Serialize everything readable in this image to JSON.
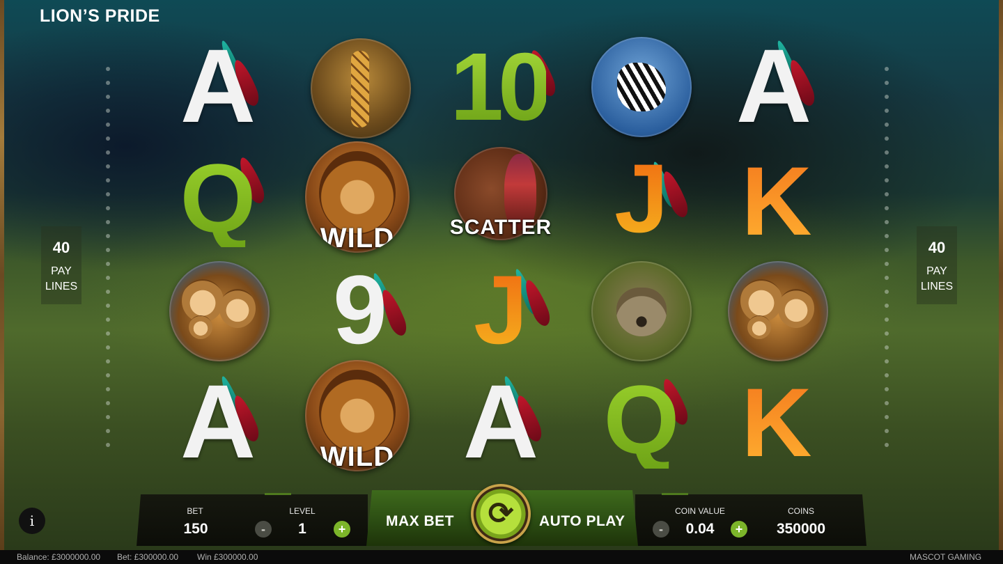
{
  "title": "LION’S PRIDE",
  "paylines": {
    "count": "40",
    "label_line1": "PAY",
    "label_line2": "LINES"
  },
  "reels": {
    "r1": {
      "a1": "A",
      "q": "Q",
      "a2": "A"
    },
    "r2": {
      "wild1": "WILD",
      "wild2": "WILD"
    },
    "r3": {
      "ten": "10",
      "scatter": "SCATTER",
      "j": "J",
      "a": "A"
    },
    "r4": {
      "j": "J",
      "q": "Q"
    },
    "r5": {
      "a": "A",
      "k1": "K",
      "k2": "K"
    },
    "r2b": {
      "nine": "9"
    }
  },
  "controls": {
    "bet_label": "BET",
    "bet_value": "150",
    "level_label": "LEVEL",
    "level_value": "1",
    "max_bet": "MAX BET",
    "auto_play": "AUTO PLAY",
    "coin_value_label": "COIN VALUE",
    "coin_value": "0.04",
    "coins_label": "COINS",
    "coins_value": "350000",
    "minus": "-",
    "plus": "+",
    "spin_symbol": "⟳",
    "info": "i"
  },
  "status": {
    "balance": "Balance: £3000000.00",
    "bet": "Bet: £300000.00",
    "win": "Win £300000.00",
    "brand": "MASCOT GAMING"
  },
  "icons": {
    "giraffe": "giraffe-icon",
    "zebra": "zebra-icon",
    "lion_family": "lion-family-icon",
    "hyena": "hyena-icon",
    "wild": "lion-wild-icon",
    "scatter": "mask-scatter-icon"
  },
  "colors": {
    "accent_green": "#7cb52a",
    "panel_dark": "#0c0d08",
    "status_bg": "#0b0b0b"
  }
}
